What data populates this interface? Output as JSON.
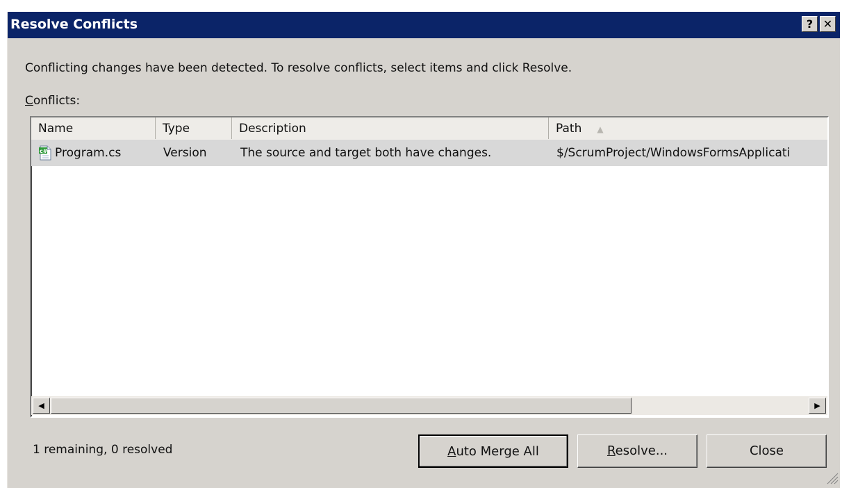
{
  "window": {
    "title": "Resolve Conflicts",
    "help_glyph": "?",
    "close_glyph": "✕"
  },
  "instruction": "Conflicting changes have been detected. To resolve conflicts, select items and click Resolve.",
  "conflicts_label_first": "C",
  "conflicts_label_rest": "onflicts:",
  "table": {
    "columns": [
      "Name",
      "Type",
      "Description",
      "Path"
    ],
    "sort_indicator": "▲",
    "rows": [
      {
        "name": "Program.cs",
        "type": "Version",
        "description": "The source and target both have changes.",
        "path": "$/ScrumProject/WindowsFormsApplicati",
        "selected": true
      }
    ]
  },
  "scrollbar": {
    "left_glyph": "◀",
    "right_glyph": "▶"
  },
  "status": "1 remaining, 0 resolved",
  "buttons": {
    "auto_merge": {
      "mnemonic": "A",
      "rest": "uto Merge All"
    },
    "resolve": {
      "mnemonic": "R",
      "rest": "esolve..."
    },
    "close": "Close"
  },
  "colors": {
    "titlebar": "#0b2468",
    "dialog_bg": "#d6d3ce",
    "selected_row": "#d8d8d8"
  }
}
